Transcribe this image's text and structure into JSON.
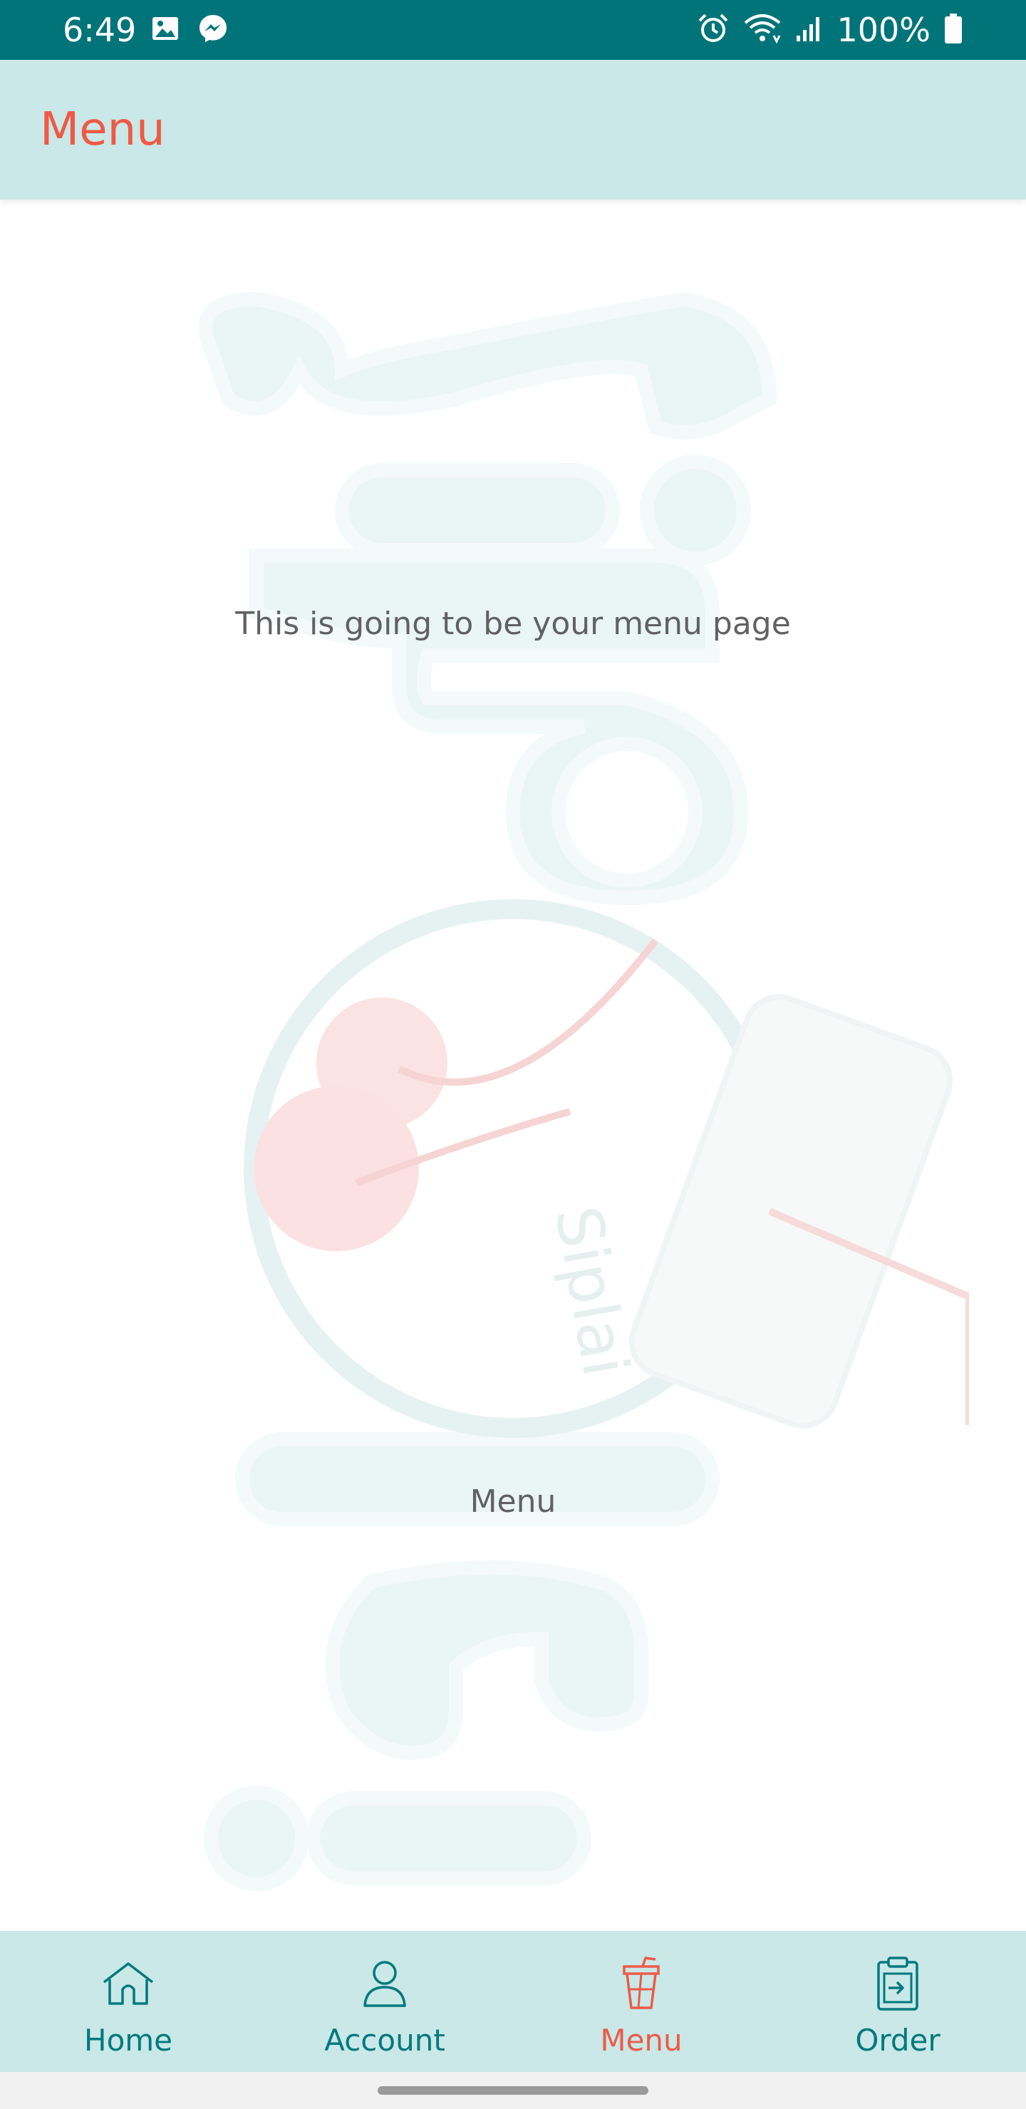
{
  "status_bar": {
    "time": "6:49",
    "left_icons": [
      "image-icon",
      "messenger-icon"
    ],
    "right_icons": [
      "alarm-icon",
      "wifi-icon",
      "signal-icon",
      "battery-icon"
    ],
    "battery": "100%"
  },
  "app_bar": {
    "title": "Menu"
  },
  "content": {
    "message": "This is going to be your menu page",
    "label": "Menu",
    "watermark_icon": "siplai-logo-watermark"
  },
  "bottom_nav": {
    "items": [
      {
        "label": "Home",
        "icon": "home-icon",
        "active": false
      },
      {
        "label": "Account",
        "icon": "account-icon",
        "active": false
      },
      {
        "label": "Menu",
        "icon": "drink-cup-icon",
        "active": true
      },
      {
        "label": "Order",
        "icon": "order-clipboard-icon",
        "active": false
      }
    ]
  },
  "colors": {
    "status_bar": "#007479",
    "app_bar": "#c9e8e7",
    "accent": "#ee5a47",
    "nav_inactive": "#00797e",
    "text_muted": "#616161"
  }
}
